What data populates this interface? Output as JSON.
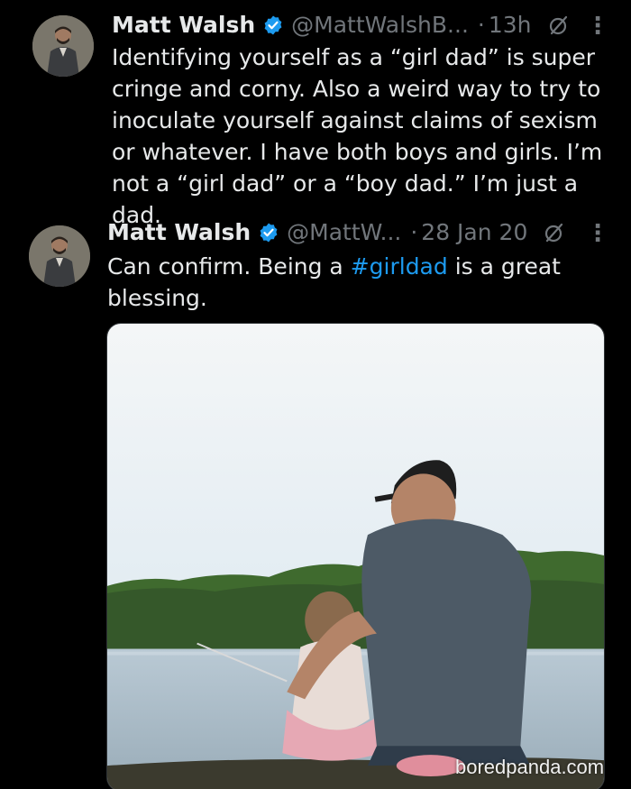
{
  "tweets": [
    {
      "author_name": "Matt Walsh",
      "handle": "@MattWalshB...",
      "separator": "·",
      "time": "13h",
      "text": "Identifying yourself as a “girl dad” is super\ncringe and corny. Also a weird way to try to\ninoculate yourself against claims of sexism\nor whatever. I have both boys and girls. I’m\nnot a “girl dad” or a “boy dad.” I’m just a dad."
    },
    {
      "author_name": "Matt Walsh",
      "handle": "@MattW...",
      "separator": "·",
      "time": "28 Jan 20",
      "text_before": "Can confirm. Being a ",
      "hashtag": "#girldad",
      "text_after": " is a great\nblessing."
    }
  ],
  "icons": {
    "verified": "verified-badge-icon",
    "grok": "grok-icon",
    "more": "more-options-icon",
    "more_glyph": "⋮"
  },
  "colors": {
    "background": "#000000",
    "text": "#e7e9ea",
    "muted": "#71767b",
    "link": "#1d9bf0",
    "verified": "#1d9bf0"
  },
  "watermark": "boredpanda.com"
}
